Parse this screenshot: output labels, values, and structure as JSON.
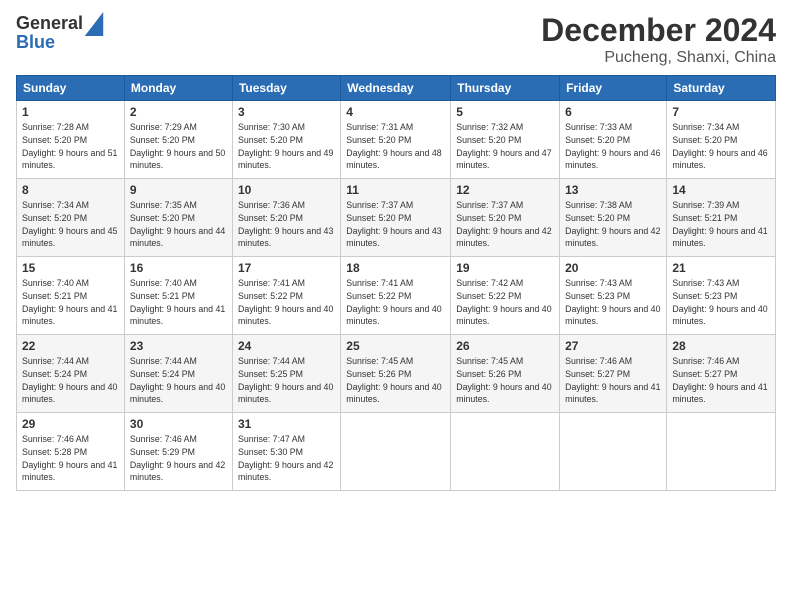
{
  "header": {
    "logo_line1": "General",
    "logo_line2": "Blue",
    "month": "December 2024",
    "location": "Pucheng, Shanxi, China"
  },
  "weekdays": [
    "Sunday",
    "Monday",
    "Tuesday",
    "Wednesday",
    "Thursday",
    "Friday",
    "Saturday"
  ],
  "weeks": [
    [
      {
        "day": "1",
        "rise": "7:28 AM",
        "set": "5:20 PM",
        "hours": "9 hours and 51 minutes."
      },
      {
        "day": "2",
        "rise": "7:29 AM",
        "set": "5:20 PM",
        "hours": "9 hours and 50 minutes."
      },
      {
        "day": "3",
        "rise": "7:30 AM",
        "set": "5:20 PM",
        "hours": "9 hours and 49 minutes."
      },
      {
        "day": "4",
        "rise": "7:31 AM",
        "set": "5:20 PM",
        "hours": "9 hours and 48 minutes."
      },
      {
        "day": "5",
        "rise": "7:32 AM",
        "set": "5:20 PM",
        "hours": "9 hours and 47 minutes."
      },
      {
        "day": "6",
        "rise": "7:33 AM",
        "set": "5:20 PM",
        "hours": "9 hours and 46 minutes."
      },
      {
        "day": "7",
        "rise": "7:34 AM",
        "set": "5:20 PM",
        "hours": "9 hours and 46 minutes."
      }
    ],
    [
      {
        "day": "8",
        "rise": "7:34 AM",
        "set": "5:20 PM",
        "hours": "9 hours and 45 minutes."
      },
      {
        "day": "9",
        "rise": "7:35 AM",
        "set": "5:20 PM",
        "hours": "9 hours and 44 minutes."
      },
      {
        "day": "10",
        "rise": "7:36 AM",
        "set": "5:20 PM",
        "hours": "9 hours and 43 minutes."
      },
      {
        "day": "11",
        "rise": "7:37 AM",
        "set": "5:20 PM",
        "hours": "9 hours and 43 minutes."
      },
      {
        "day": "12",
        "rise": "7:37 AM",
        "set": "5:20 PM",
        "hours": "9 hours and 42 minutes."
      },
      {
        "day": "13",
        "rise": "7:38 AM",
        "set": "5:20 PM",
        "hours": "9 hours and 42 minutes."
      },
      {
        "day": "14",
        "rise": "7:39 AM",
        "set": "5:21 PM",
        "hours": "9 hours and 41 minutes."
      }
    ],
    [
      {
        "day": "15",
        "rise": "7:40 AM",
        "set": "5:21 PM",
        "hours": "9 hours and 41 minutes."
      },
      {
        "day": "16",
        "rise": "7:40 AM",
        "set": "5:21 PM",
        "hours": "9 hours and 41 minutes."
      },
      {
        "day": "17",
        "rise": "7:41 AM",
        "set": "5:22 PM",
        "hours": "9 hours and 40 minutes."
      },
      {
        "day": "18",
        "rise": "7:41 AM",
        "set": "5:22 PM",
        "hours": "9 hours and 40 minutes."
      },
      {
        "day": "19",
        "rise": "7:42 AM",
        "set": "5:22 PM",
        "hours": "9 hours and 40 minutes."
      },
      {
        "day": "20",
        "rise": "7:43 AM",
        "set": "5:23 PM",
        "hours": "9 hours and 40 minutes."
      },
      {
        "day": "21",
        "rise": "7:43 AM",
        "set": "5:23 PM",
        "hours": "9 hours and 40 minutes."
      }
    ],
    [
      {
        "day": "22",
        "rise": "7:44 AM",
        "set": "5:24 PM",
        "hours": "9 hours and 40 minutes."
      },
      {
        "day": "23",
        "rise": "7:44 AM",
        "set": "5:24 PM",
        "hours": "9 hours and 40 minutes."
      },
      {
        "day": "24",
        "rise": "7:44 AM",
        "set": "5:25 PM",
        "hours": "9 hours and 40 minutes."
      },
      {
        "day": "25",
        "rise": "7:45 AM",
        "set": "5:26 PM",
        "hours": "9 hours and 40 minutes."
      },
      {
        "day": "26",
        "rise": "7:45 AM",
        "set": "5:26 PM",
        "hours": "9 hours and 40 minutes."
      },
      {
        "day": "27",
        "rise": "7:46 AM",
        "set": "5:27 PM",
        "hours": "9 hours and 41 minutes."
      },
      {
        "day": "28",
        "rise": "7:46 AM",
        "set": "5:27 PM",
        "hours": "9 hours and 41 minutes."
      }
    ],
    [
      {
        "day": "29",
        "rise": "7:46 AM",
        "set": "5:28 PM",
        "hours": "9 hours and 41 minutes."
      },
      {
        "day": "30",
        "rise": "7:46 AM",
        "set": "5:29 PM",
        "hours": "9 hours and 42 minutes."
      },
      {
        "day": "31",
        "rise": "7:47 AM",
        "set": "5:30 PM",
        "hours": "9 hours and 42 minutes."
      },
      null,
      null,
      null,
      null
    ]
  ],
  "labels": {
    "sunrise": "Sunrise:",
    "sunset": "Sunset:",
    "daylight": "Daylight:"
  }
}
